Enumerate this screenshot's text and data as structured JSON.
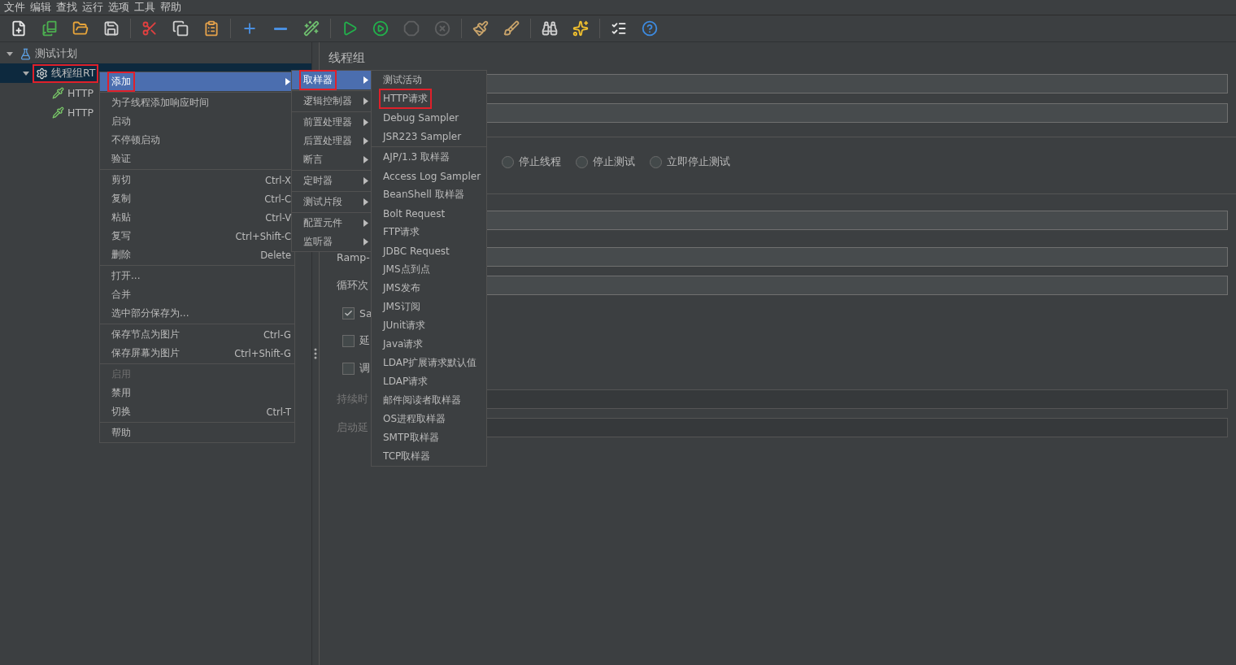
{
  "menu_bar": [
    "文件",
    "编辑",
    "查找",
    "运行",
    "选项",
    "工具",
    "帮助"
  ],
  "toolbar_groups": [
    {
      "items": [
        {
          "kind": "new",
          "disabled": false
        },
        {
          "kind": "templates",
          "disabled": false
        },
        {
          "kind": "open",
          "disabled": false
        },
        {
          "kind": "save",
          "disabled": false
        }
      ]
    },
    {
      "items": [
        {
          "kind": "cut",
          "disabled": false
        },
        {
          "kind": "copy",
          "disabled": false
        },
        {
          "kind": "paste",
          "disabled": false
        }
      ]
    },
    {
      "items": [
        {
          "kind": "expand",
          "disabled": false
        },
        {
          "kind": "collapse",
          "disabled": false
        },
        {
          "kind": "toggle",
          "disabled": false
        }
      ]
    },
    {
      "items": [
        {
          "kind": "start",
          "disabled": false
        },
        {
          "kind": "start_no_pause",
          "disabled": false
        },
        {
          "kind": "stop",
          "disabled": true
        },
        {
          "kind": "shutdown",
          "disabled": true
        }
      ]
    },
    {
      "items": [
        {
          "kind": "clear",
          "disabled": false
        },
        {
          "kind": "clear_all",
          "disabled": false
        }
      ]
    },
    {
      "items": [
        {
          "kind": "search",
          "disabled": false
        },
        {
          "kind": "reset_search",
          "disabled": false
        }
      ]
    },
    {
      "items": [
        {
          "kind": "function_helper",
          "disabled": false
        },
        {
          "kind": "help",
          "disabled": false
        }
      ]
    }
  ],
  "tree": [
    {
      "label": "测试计划",
      "kind": "plan",
      "expanded": true,
      "selected": false,
      "annotated": false,
      "children": [
        {
          "label": "线程组RT",
          "kind": "thread_group",
          "expanded": true,
          "selected": true,
          "annotated": true,
          "children": [
            {
              "label": "HTTP",
              "kind": "sampler",
              "selected": false,
              "annotated": false
            },
            {
              "label": "HTTP",
              "kind": "sampler",
              "selected": false,
              "annotated": false
            }
          ]
        }
      ]
    }
  ],
  "panel": {
    "title": "线程组",
    "error_actions": [
      {
        "label": "停止线程",
        "selected": false
      },
      {
        "label": "停止测试",
        "selected": false
      },
      {
        "label": "立即停止测试",
        "selected": false
      }
    ],
    "thread_rows": [
      {
        "kind": "field",
        "disabled": false
      },
      {
        "kind": "field",
        "label": "Ramp-",
        "disabled": false
      },
      {
        "kind": "field",
        "label": "循环次",
        "disabled": false
      },
      {
        "kind": "checkbox",
        "label": "Sa",
        "checked": true
      },
      {
        "kind": "checkbox",
        "label": "延",
        "checked": false
      },
      {
        "kind": "checkbox",
        "label": "调",
        "checked": false
      },
      {
        "kind": "field",
        "label": "持续时",
        "disabled": true
      },
      {
        "kind": "field",
        "label": "启动延",
        "disabled": true
      }
    ]
  },
  "context_menus": [
    {
      "groups": [
        {
          "items": [
            {
              "label": "添加",
              "selected": true,
              "disabled": false,
              "annotated": true,
              "submenu": true
            }
          ]
        },
        {
          "items": [
            {
              "label": "为子线程添加响应时间",
              "selected": false,
              "disabled": false,
              "annotated": false,
              "submenu": false
            },
            {
              "label": "启动",
              "selected": false,
              "disabled": false,
              "annotated": false,
              "submenu": false
            },
            {
              "label": "不停顿启动",
              "selected": false,
              "disabled": false,
              "annotated": false,
              "submenu": false
            },
            {
              "label": "验证",
              "selected": false,
              "disabled": false,
              "annotated": false,
              "submenu": false
            }
          ]
        },
        {
          "items": [
            {
              "label": "剪切",
              "shortcut": "Ctrl-X",
              "selected": false,
              "disabled": false,
              "annotated": false,
              "submenu": false
            },
            {
              "label": "复制",
              "shortcut": "Ctrl-C",
              "selected": false,
              "disabled": false,
              "annotated": false,
              "submenu": false
            },
            {
              "label": "粘贴",
              "shortcut": "Ctrl-V",
              "selected": false,
              "disabled": false,
              "annotated": false,
              "submenu": false
            },
            {
              "label": "复写",
              "shortcut": "Ctrl+Shift-C",
              "selected": false,
              "disabled": false,
              "annotated": false,
              "submenu": false
            },
            {
              "label": "删除",
              "shortcut": "Delete",
              "selected": false,
              "disabled": false,
              "annotated": false,
              "submenu": false
            }
          ]
        },
        {
          "items": [
            {
              "label": "打开...",
              "selected": false,
              "disabled": false,
              "annotated": false,
              "submenu": false
            },
            {
              "label": "合并",
              "selected": false,
              "disabled": false,
              "annotated": false,
              "submenu": false
            },
            {
              "label": "选中部分保存为...",
              "selected": false,
              "disabled": false,
              "annotated": false,
              "submenu": false
            }
          ]
        },
        {
          "items": [
            {
              "label": "保存节点为图片",
              "shortcut": "Ctrl-G",
              "selected": false,
              "disabled": false,
              "annotated": false,
              "submenu": false
            },
            {
              "label": "保存屏幕为图片",
              "shortcut": "Ctrl+Shift-G",
              "selected": false,
              "disabled": false,
              "annotated": false,
              "submenu": false
            }
          ]
        },
        {
          "items": [
            {
              "label": "启用",
              "selected": false,
              "disabled": true,
              "annotated": false,
              "submenu": false
            },
            {
              "label": "禁用",
              "selected": false,
              "disabled": false,
              "annotated": false,
              "submenu": false
            },
            {
              "label": "切换",
              "shortcut": "Ctrl-T",
              "selected": false,
              "disabled": false,
              "annotated": false,
              "submenu": false
            }
          ]
        },
        {
          "items": [
            {
              "label": "帮助",
              "selected": false,
              "disabled": false,
              "annotated": false,
              "submenu": false
            }
          ]
        }
      ]
    },
    {
      "groups": [
        {
          "items": [
            {
              "label": "取样器",
              "selected": true,
              "disabled": false,
              "annotated": true,
              "submenu": true
            }
          ]
        },
        {
          "items": [
            {
              "label": "逻辑控制器",
              "selected": false,
              "disabled": false,
              "annotated": false,
              "submenu": true
            }
          ]
        },
        {
          "items": [
            {
              "label": "前置处理器",
              "selected": false,
              "disabled": false,
              "annotated": false,
              "submenu": true
            },
            {
              "label": "后置处理器",
              "selected": false,
              "disabled": false,
              "annotated": false,
              "submenu": true
            },
            {
              "label": "断言",
              "selected": false,
              "disabled": false,
              "annotated": false,
              "submenu": true
            }
          ]
        },
        {
          "items": [
            {
              "label": "定时器",
              "selected": false,
              "disabled": false,
              "annotated": false,
              "submenu": true
            }
          ]
        },
        {
          "items": [
            {
              "label": "测试片段",
              "selected": false,
              "disabled": false,
              "annotated": false,
              "submenu": true
            }
          ]
        },
        {
          "items": [
            {
              "label": "配置元件",
              "selected": false,
              "disabled": false,
              "annotated": false,
              "submenu": true
            },
            {
              "label": "监听器",
              "selected": false,
              "disabled": false,
              "annotated": false,
              "submenu": true
            }
          ]
        }
      ]
    },
    {
      "groups": [
        {
          "items": [
            {
              "label": "测试活动",
              "selected": false,
              "disabled": false,
              "annotated": false,
              "submenu": false
            },
            {
              "label": "HTTP请求",
              "selected": false,
              "disabled": false,
              "annotated": true,
              "submenu": false
            },
            {
              "label": "Debug Sampler",
              "selected": false,
              "disabled": false,
              "annotated": false,
              "submenu": false
            },
            {
              "label": "JSR223 Sampler",
              "selected": false,
              "disabled": false,
              "annotated": false,
              "submenu": false
            }
          ]
        },
        {
          "items": [
            {
              "label": "AJP/1.3 取样器",
              "selected": false,
              "disabled": false,
              "annotated": false,
              "submenu": false
            },
            {
              "label": "Access Log Sampler",
              "selected": false,
              "disabled": false,
              "annotated": false,
              "submenu": false
            },
            {
              "label": "BeanShell 取样器",
              "selected": false,
              "disabled": false,
              "annotated": false,
              "submenu": false
            },
            {
              "label": "Bolt Request",
              "selected": false,
              "disabled": false,
              "annotated": false,
              "submenu": false
            },
            {
              "label": "FTP请求",
              "selected": false,
              "disabled": false,
              "annotated": false,
              "submenu": false
            },
            {
              "label": "JDBC Request",
              "selected": false,
              "disabled": false,
              "annotated": false,
              "submenu": false
            },
            {
              "label": "JMS点到点",
              "selected": false,
              "disabled": false,
              "annotated": false,
              "submenu": false
            },
            {
              "label": "JMS发布",
              "selected": false,
              "disabled": false,
              "annotated": false,
              "submenu": false
            },
            {
              "label": "JMS订阅",
              "selected": false,
              "disabled": false,
              "annotated": false,
              "submenu": false
            },
            {
              "label": "JUnit请求",
              "selected": false,
              "disabled": false,
              "annotated": false,
              "submenu": false
            },
            {
              "label": "Java请求",
              "selected": false,
              "disabled": false,
              "annotated": false,
              "submenu": false
            },
            {
              "label": "LDAP扩展请求默认值",
              "selected": false,
              "disabled": false,
              "annotated": false,
              "submenu": false
            },
            {
              "label": "LDAP请求",
              "selected": false,
              "disabled": false,
              "annotated": false,
              "submenu": false
            },
            {
              "label": "邮件阅读者取样器",
              "selected": false,
              "disabled": false,
              "annotated": false,
              "submenu": false
            },
            {
              "label": "OS进程取样器",
              "selected": false,
              "disabled": false,
              "annotated": false,
              "submenu": false
            },
            {
              "label": "SMTP取样器",
              "selected": false,
              "disabled": false,
              "annotated": false,
              "submenu": false
            },
            {
              "label": "TCP取样器",
              "selected": false,
              "disabled": false,
              "annotated": false,
              "submenu": false
            }
          ]
        }
      ]
    }
  ]
}
